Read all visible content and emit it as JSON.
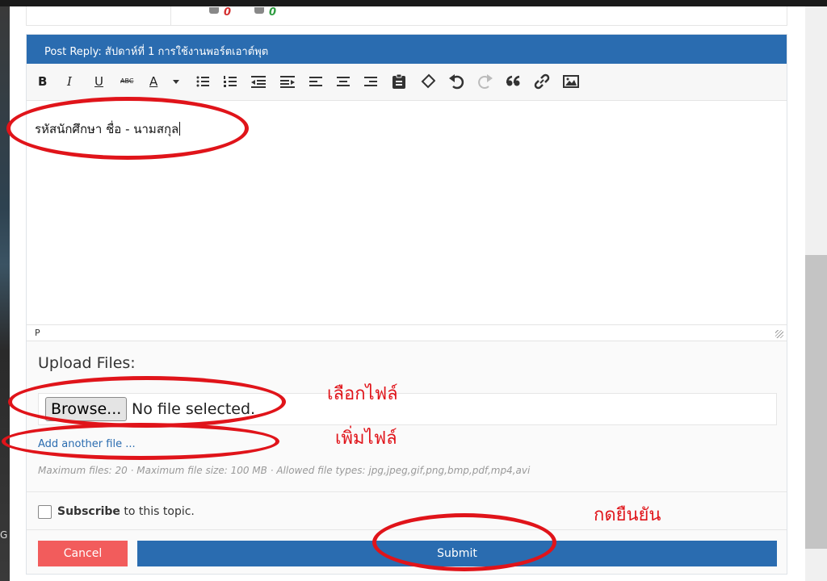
{
  "prev_post": {
    "votes_down": "0",
    "votes_up": "0"
  },
  "reply": {
    "header_title": "Post Reply: สัปดาห์ที่ 1 การใช้งานพอร์ตเอาต์พุต"
  },
  "toolbar": {
    "items": [
      "B",
      "I",
      "U",
      "ABC",
      "A"
    ]
  },
  "editor": {
    "content": "รหัสนักศึกษา ชื่อ - นามสกุล",
    "status_path": "P"
  },
  "upload": {
    "title": "Upload Files:",
    "browse_label": "Browse...",
    "no_file_text": "No file selected.",
    "add_another": "Add another file ...",
    "limits": "Maximum files: 20 · Maximum file size: 100 MB · Allowed file types: jpg,jpeg,gif,png,bmp,pdf,mp4,avi"
  },
  "subscribe": {
    "bold": "Subscribe",
    "rest": "to this topic."
  },
  "actions": {
    "cancel": "Cancel",
    "submit": "Submit"
  },
  "annotations": {
    "choose_file": "เลือกไฟล์",
    "add_file": "เพิ่มไฟล์",
    "confirm": "กดยืนยัน"
  },
  "colors": {
    "header_blue": "#2a6cb0",
    "cancel_red": "#f25c5c",
    "annotation_red": "#e0141a"
  },
  "left_edge_label": "G"
}
